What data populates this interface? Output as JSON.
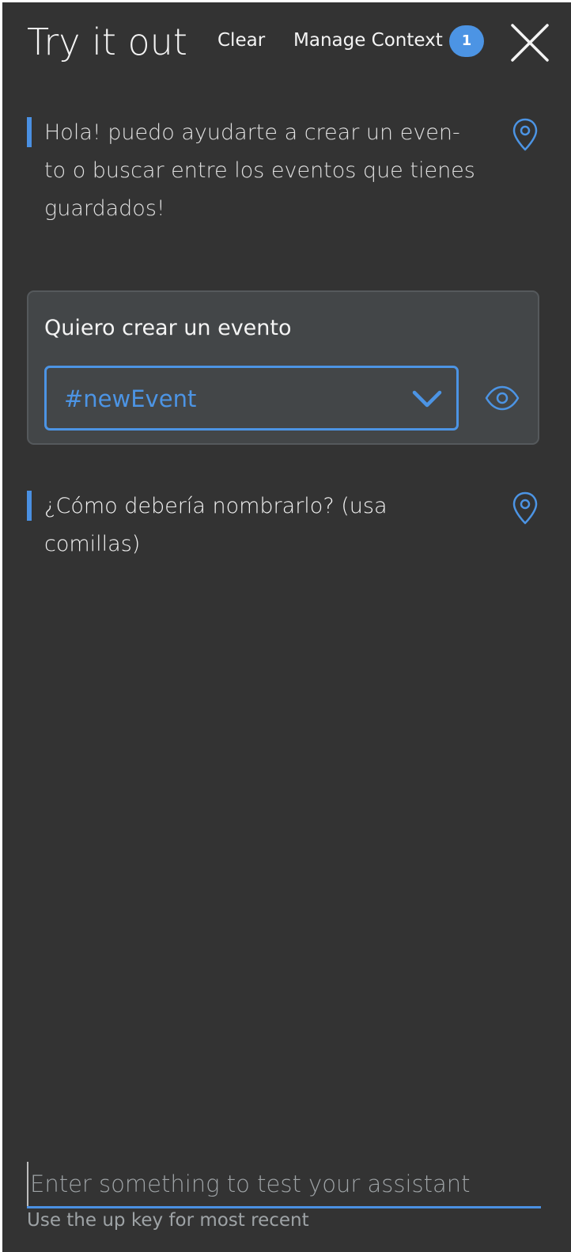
{
  "header": {
    "title": "Try it out",
    "clear_label": "Clear",
    "manage_context_label": "Manage Context",
    "context_count": "1"
  },
  "messages": [
    {
      "role": "assistant",
      "text": "Hola! puedo ayudarte a crear un even- to o buscar entre los eventos que tienes guardados!",
      "icon": "location-pin-icon"
    },
    {
      "role": "user",
      "text": "Quiero crear un evento",
      "intent": "#newEvent",
      "icon": "eye-icon"
    },
    {
      "role": "assistant",
      "text": "¿Cómo debería nombrarlo? (usa comillas)",
      "icon": "location-pin-icon"
    }
  ],
  "input": {
    "value": "",
    "placeholder": "Enter something to test your assistant",
    "hint": "Use the up key for most recent"
  },
  "colors": {
    "panel_bg": "#333333",
    "card_bg": "#434648",
    "accent": "#4c94e4",
    "text": "#f4f4f4"
  }
}
